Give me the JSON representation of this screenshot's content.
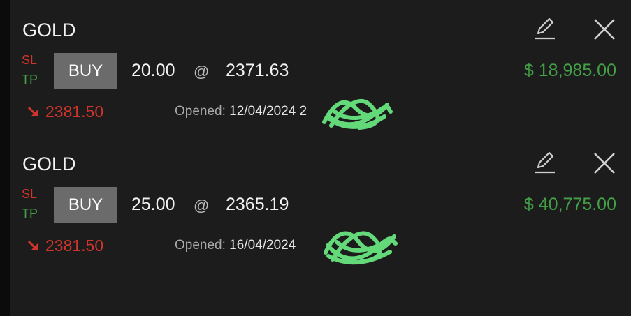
{
  "positions": [
    {
      "symbol": "GOLD",
      "sl_label": "SL",
      "tp_label": "TP",
      "side": "BUY",
      "volume": "20.00",
      "at": "@",
      "open_price": "2371.63",
      "profit": "$ 18,985.00",
      "current_price": "2381.50",
      "opened_label": "Opened: ",
      "opened_date": "12/04/2024 2"
    },
    {
      "symbol": "GOLD",
      "sl_label": "SL",
      "tp_label": "TP",
      "side": "BUY",
      "volume": "25.00",
      "at": "@",
      "open_price": "2365.19",
      "profit": "$ 40,775.00",
      "current_price": "2381.50",
      "opened_label": "Opened: ",
      "opened_date": "16/04/2024"
    }
  ],
  "icons": {
    "edit": "pencil-icon",
    "close": "close-icon",
    "direction": "arrow-down-right-icon"
  },
  "colors": {
    "background": "#1c1c1c",
    "loss_red": "#d0342c",
    "profit_green": "#43a047",
    "button_gray": "#6b6b6b",
    "redaction_green": "#63d97a"
  }
}
